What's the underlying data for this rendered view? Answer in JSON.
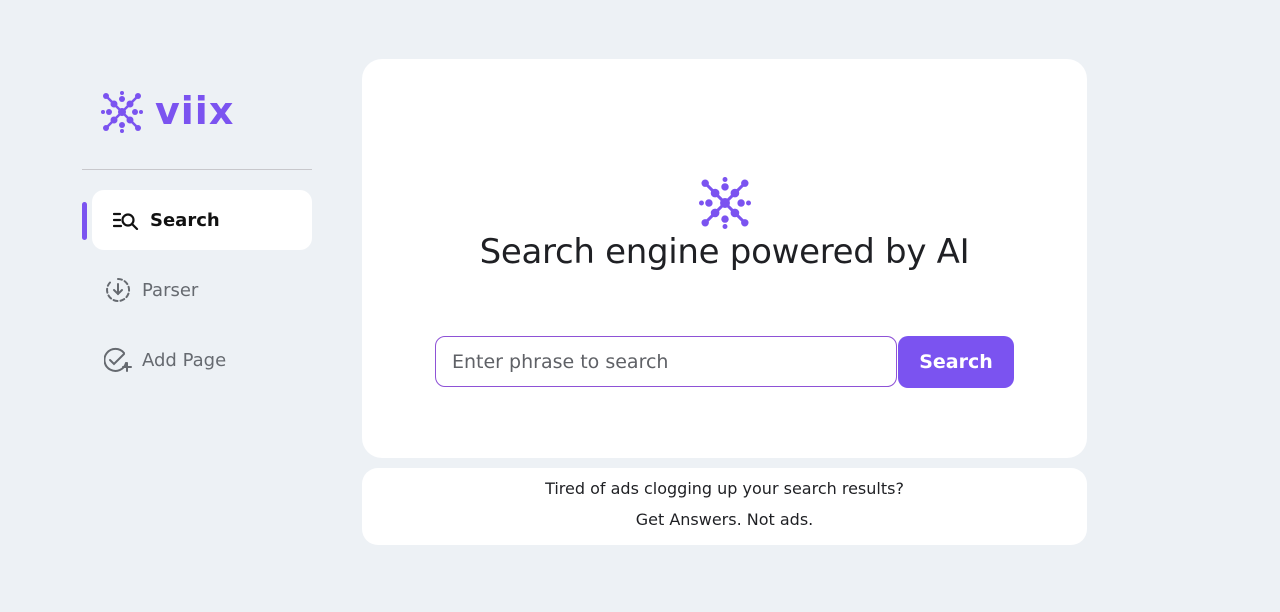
{
  "brand": {
    "name": "viix",
    "accent_color": "#7b53f0"
  },
  "sidebar": {
    "items": [
      {
        "label": "Search",
        "icon": "search-list-icon",
        "active": true
      },
      {
        "label": "Parser",
        "icon": "download-circle-icon",
        "active": false
      },
      {
        "label": "Add Page",
        "icon": "check-add-icon",
        "active": false
      }
    ]
  },
  "main": {
    "title": "Search engine powered by AI",
    "search": {
      "placeholder": "Enter phrase to search",
      "value": "",
      "button_label": "Search"
    }
  },
  "footer": {
    "line1": "Tired of ads clogging up your search results?",
    "line2": "Get Answers. Not ads."
  }
}
